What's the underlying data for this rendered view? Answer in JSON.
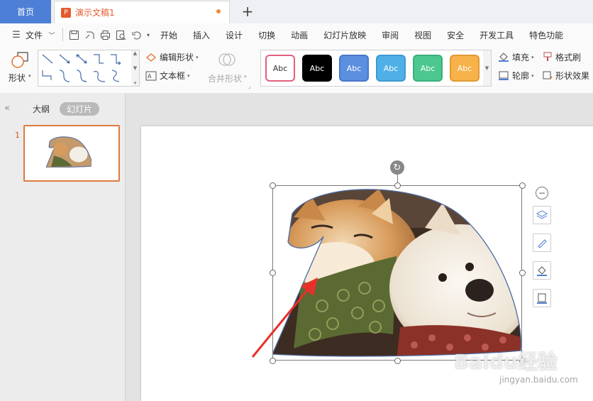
{
  "tabs": {
    "home": "首页",
    "doc": "演示文稿1",
    "doc_icon": "P",
    "add": "+"
  },
  "menu": {
    "file": "文件",
    "items": [
      "开始",
      "插入",
      "设计",
      "切换",
      "动画",
      "幻灯片放映",
      "审阅",
      "视图",
      "安全",
      "开发工具",
      "特色功能"
    ]
  },
  "ribbon": {
    "shape": "形状",
    "edit_shape": "编辑形状",
    "text_box": "文本框",
    "merge_shape": "合并形状",
    "fill": "填充",
    "outline": "轮廓",
    "format_brush": "格式刷",
    "shape_effect": "形状效果",
    "styles": [
      {
        "label": "Abc",
        "bg": "#ffffff",
        "border": "#e0607a",
        "color": "#333333"
      },
      {
        "label": "Abc",
        "bg": "#000000",
        "border": "#000000",
        "color": "#ffffff"
      },
      {
        "label": "Abc",
        "bg": "#5b8fe0",
        "border": "#4a78c8",
        "color": "#ffffff"
      },
      {
        "label": "Abc",
        "bg": "#4fb0e8",
        "border": "#3f9ad0",
        "color": "#ffffff"
      },
      {
        "label": "Abc",
        "bg": "#4cc790",
        "border": "#3cae7a",
        "color": "#ffffff"
      },
      {
        "label": "Abc",
        "bg": "#f8b24a",
        "border": "#e09a33",
        "color": "#ffffff"
      }
    ]
  },
  "panel": {
    "outline_tab": "大纲",
    "slides_tab": "幻灯片",
    "slide_number": "1"
  },
  "watermark": {
    "logo": "Baidu经验",
    "url": "jingyan.baidu.com"
  },
  "colors": {
    "accent": "#4d7fd6",
    "doc_orange": "#e35b2f",
    "arrow": "#e8302b"
  }
}
